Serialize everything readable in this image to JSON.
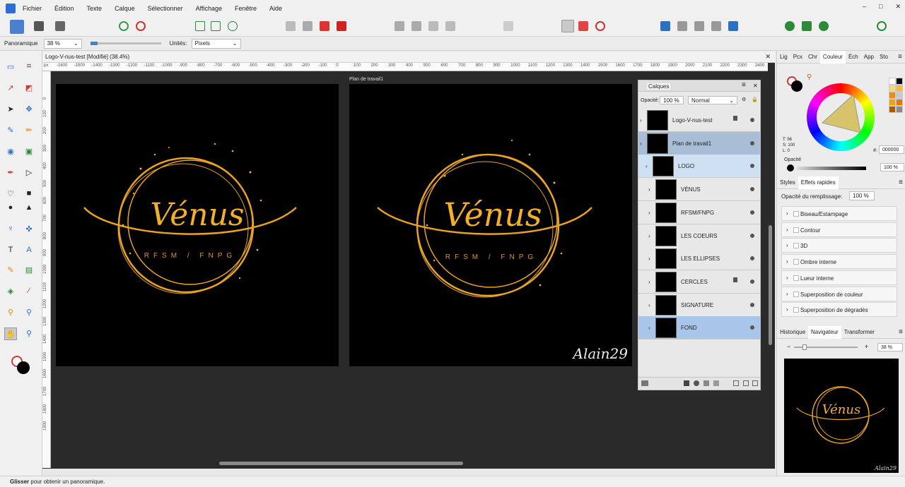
{
  "menu": [
    "Fichier",
    "Édition",
    "Texte",
    "Calque",
    "Sélectionner",
    "Affichage",
    "Fenêtre",
    "Aide"
  ],
  "window_controls": [
    "–",
    "□",
    "✕"
  ],
  "context_bar": {
    "tool_label": "Panoramique",
    "zoom": "38 %",
    "units_label": "Unités:",
    "units_value": "Pixels"
  },
  "document_tab": "Logo-V-nus-test [Modifié] (38.4%)",
  "ruler_unit": "px",
  "ruler_top": [
    "-1600",
    "-1500",
    "-1400",
    "-1300",
    "-1200",
    "-1100",
    "-1000",
    "-900",
    "-800",
    "-700",
    "-600",
    "-500",
    "-400",
    "-300",
    "-200",
    "-100",
    "0",
    "100",
    "200",
    "300",
    "400",
    "500",
    "600",
    "700",
    "800",
    "900",
    "1000",
    "1100",
    "1200",
    "1300",
    "1400",
    "1500",
    "1600",
    "1700",
    "1800",
    "1900",
    "2000",
    "2100",
    "2200",
    "2300",
    "2400"
  ],
  "ruler_left": [
    "0",
    "100",
    "200",
    "300",
    "400",
    "500",
    "600",
    "700",
    "800",
    "900",
    "1000",
    "1100",
    "1200",
    "1300",
    "1400",
    "1500",
    "1600",
    "1700",
    "1800",
    "1900"
  ],
  "artboard_label": "Plan de travail1",
  "logo": {
    "title": "Vénus",
    "subtitle": "RFSM / FNPG"
  },
  "signature": "Alain29",
  "layers_panel": {
    "title": "Calques",
    "opacity_label": "Opacité:",
    "opacity_value": "100 %",
    "blend": "Normal",
    "rows": [
      {
        "name": "Logo-V-nus-test"
      },
      {
        "name": "Plan de travail1"
      },
      {
        "name": "LOGO"
      },
      {
        "name": "VÉNUS"
      },
      {
        "name": "RFSM/FNPG"
      },
      {
        "name": "LES COEURS"
      },
      {
        "name": "LES ELLIPSES"
      },
      {
        "name": "CERCLES"
      },
      {
        "name": "SIGNATURE"
      },
      {
        "name": "FOND"
      }
    ]
  },
  "color_panel": {
    "tabs": [
      "Lig",
      "Pcx",
      "Chr",
      "Couleur",
      "Éch",
      "App",
      "Sto"
    ],
    "t_value": "T: 56",
    "s_value": "S: 100",
    "l_value": "L: 0",
    "hex_label": "#:",
    "hex": "000000",
    "opacity_label": "Opacité",
    "opacity_value": "100 %",
    "swatches": [
      "#ffffff",
      "#000000",
      "#f5d77a",
      "#f2b84b",
      "#e88b1a",
      "#c9c9c9",
      "#f3a400",
      "#e07a00",
      "#b05a00",
      "#8a8a8a"
    ]
  },
  "effects_panel": {
    "tabs": [
      "Styles",
      "Effets rapides"
    ],
    "fill_opacity_label": "Opacité du remplissage:",
    "fill_opacity_value": "100 %",
    "items": [
      "Biseau/Estampage",
      "Contour",
      "3D",
      "Ombre interne",
      "Lueur interne",
      "Superposition de couleur",
      "Superposition de dégradés"
    ]
  },
  "navigator_panel": {
    "tabs": [
      "Historique",
      "Navigateur",
      "Transformer"
    ],
    "zoom": "38 %"
  },
  "status": {
    "bold": "Glisser",
    "rest": " pour obtenir un panoramique."
  },
  "colors": {
    "gold": "#f0a81c",
    "dark": "#000000",
    "panel": "#e8e8e8",
    "accent": "#2b6fd6"
  }
}
